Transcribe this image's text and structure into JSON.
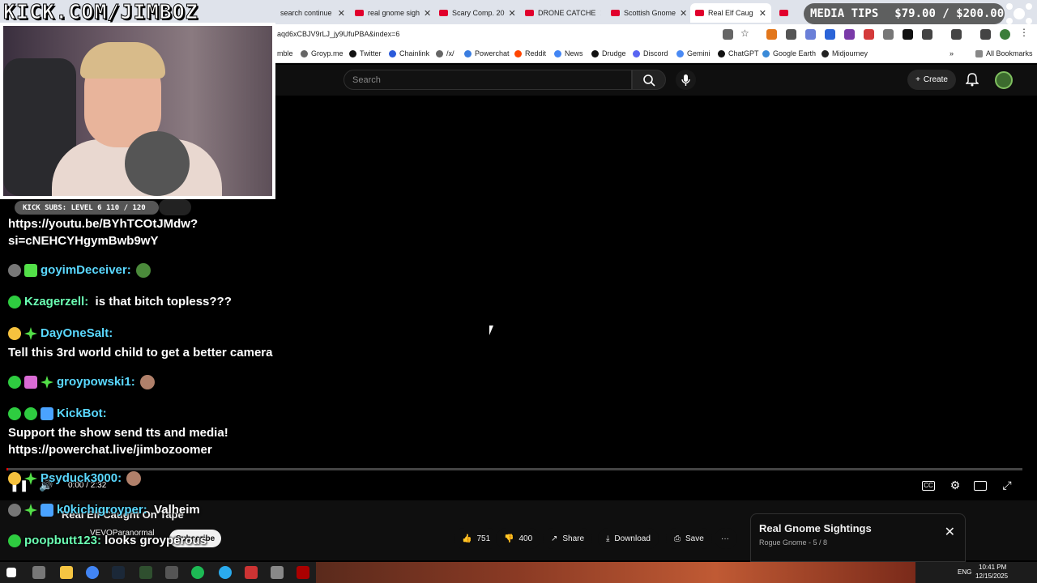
{
  "browser": {
    "tabs": [
      {
        "label": "search continue"
      },
      {
        "label": "real gnome sigh"
      },
      {
        "label": "Scary Comp. 20"
      },
      {
        "label": "DRONE CATCHE"
      },
      {
        "label": "Scottish Gnome"
      },
      {
        "label": "Real Elf Caug"
      }
    ],
    "url": "aqd6xCBJV9rLJ_jy9UfuPBA&index=6",
    "bookmarks": [
      "mble",
      "Groyp.me",
      "Twitter",
      "Chainlink",
      "/x/",
      "Powerchat",
      "Reddit",
      "News",
      "Drudge",
      "Discord",
      "Gemini",
      "ChatGPT",
      "Google Earth",
      "Midjourney"
    ],
    "all_bookmarks": "All Bookmarks"
  },
  "youtube": {
    "search_placeholder": "Search",
    "create_label": "Create",
    "video_title": "Real Elf Caught On Tape",
    "channel": "VEVOParanormal",
    "subscribe_label": "Subscribe",
    "time": "0:00 / 2:32",
    "likes": "751",
    "dislikes": "400",
    "share_label": "Share",
    "download_label": "Download",
    "save_label": "Save",
    "playlist_title": "Real Gnome Sightings",
    "playlist_sub": "Rogue Gnome - 5 / 8"
  },
  "overlay": {
    "banner": "KICK.COM/JIMBOZ",
    "subs": "KICK SUBS: LEVEL 6 110 / 120",
    "media_tips_label": "MEDIA TIPS",
    "media_tips_value": "$79.00 / $200.00"
  },
  "chat": [
    {
      "user": "",
      "text": "https://youtu.be/BYhTCOtJMdw?"
    },
    {
      "user": "",
      "text": "si=cNEHCYHgymBwb9wY"
    },
    {
      "user": "goyimDeceiver:",
      "text": ""
    },
    {
      "user": "Kzagerzell:",
      "text": "is that bitch topless???"
    },
    {
      "user": "DayOneSalt:",
      "text": ""
    },
    {
      "user": "",
      "text": "Tell this 3rd world child to get a better camera"
    },
    {
      "user": "groypowski1:",
      "text": ""
    },
    {
      "user": "KickBot:",
      "text": ""
    },
    {
      "user": "",
      "text": "Support the show send tts and media!"
    },
    {
      "user": "",
      "text": "https://powerchat.live/jimbozoomer"
    },
    {
      "user": "Psyduck3000:",
      "text": ""
    },
    {
      "user": "k0kichigroyper:",
      "text": "Valheim"
    },
    {
      "user": "poopbutt123:",
      "text": "looks groyperous"
    }
  ],
  "taskbar": {
    "lang": "ENG",
    "time": "10:41 PM",
    "date": "12/15/2025"
  },
  "colors": {
    "chat_user": "#5ad8ff",
    "yt_bg": "#0f0f0f",
    "progress": "#ff0000"
  }
}
